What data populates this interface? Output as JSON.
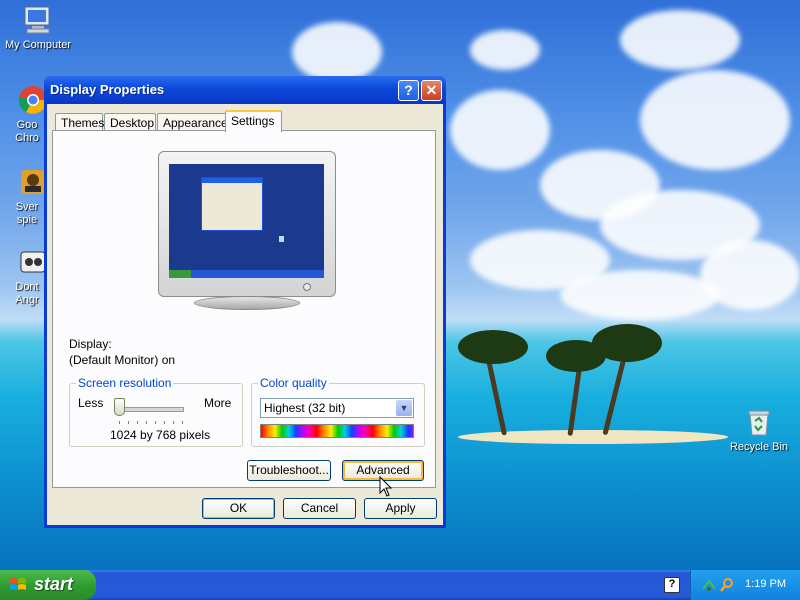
{
  "desktop": {
    "icons": [
      {
        "label": "My Computer"
      },
      {
        "label": "Goo Chro"
      },
      {
        "label": "Sver spie"
      },
      {
        "label": "Dont Angr"
      },
      {
        "label": "Recycle Bin"
      }
    ]
  },
  "window": {
    "title": "Display Properties",
    "help_label": "?",
    "close_label": "✕",
    "tabs": [
      {
        "label": "Themes"
      },
      {
        "label": "Desktop"
      },
      {
        "label": "Appearance"
      },
      {
        "label": "Settings"
      }
    ],
    "settings": {
      "display_label": "Display:",
      "display_value": "(Default Monitor) on",
      "resolution": {
        "legend": "Screen resolution",
        "less": "Less",
        "more": "More",
        "value": "1024 by 768 pixels"
      },
      "color": {
        "legend": "Color quality",
        "selected": "Highest (32 bit)"
      },
      "troubleshoot_label": "Troubleshoot...",
      "advanced_label": "Advanced"
    },
    "ok_label": "OK",
    "cancel_label": "Cancel",
    "apply_label": "Apply"
  },
  "taskbar": {
    "start_label": "start",
    "clock": "1:19 PM",
    "help_icon_label": "?"
  }
}
